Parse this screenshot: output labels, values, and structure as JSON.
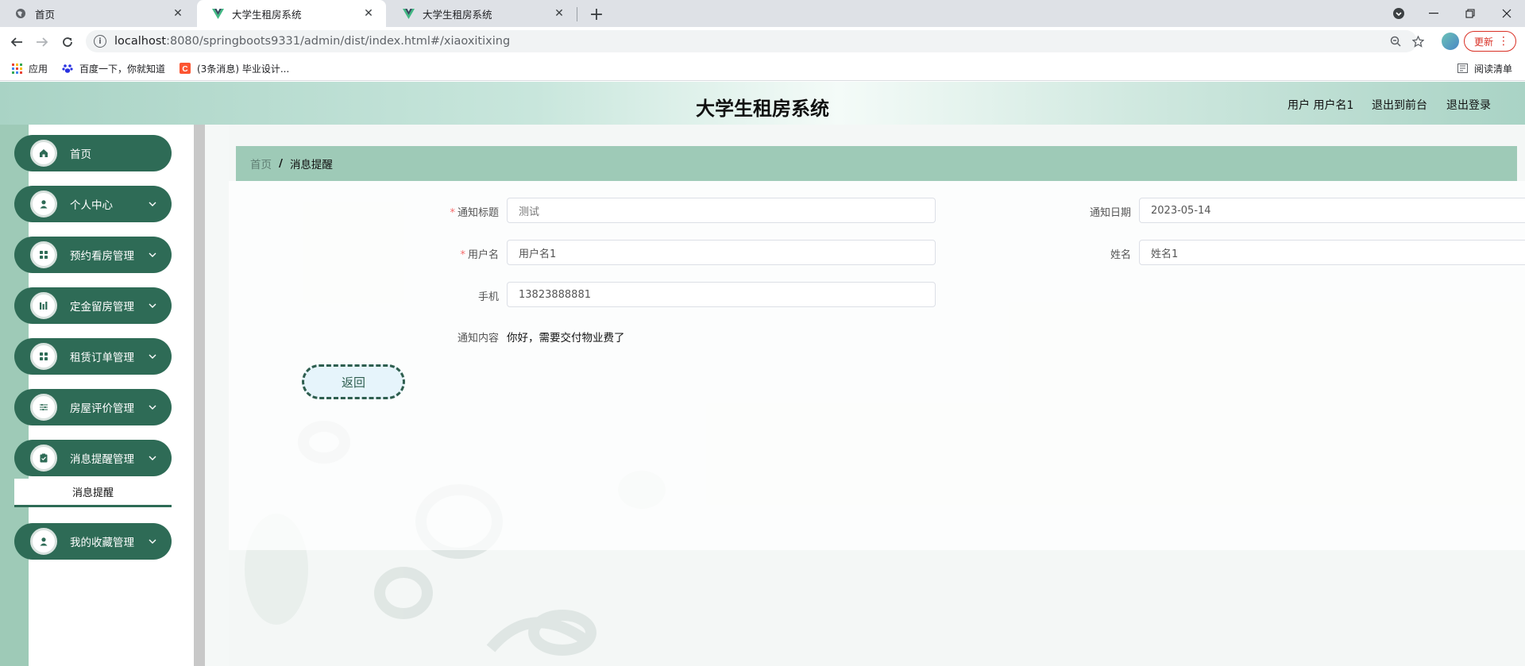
{
  "browser": {
    "tabs": [
      {
        "title": "首页",
        "icon": "globe-icon"
      },
      {
        "title": "大学生租房系统",
        "icon": "vue-icon",
        "active": true
      },
      {
        "title": "大学生租房系统",
        "icon": "vue-icon"
      }
    ],
    "address": {
      "host": "localhost",
      "rest": ":8080/springboots9331/admin/dist/index.html#/xiaoxitixing"
    },
    "update_label": "更新",
    "bookmarks": [
      {
        "label": "应用",
        "icon": "apps-grid-icon"
      },
      {
        "label": "百度一下，你就知道",
        "icon": "baidu-paw-icon"
      },
      {
        "label": "(3条消息) 毕业设计...",
        "icon": "csdn-c-icon"
      }
    ],
    "reading_list_label": "阅读清单"
  },
  "header": {
    "title": "大学生租房系统",
    "user_label": "用户 用户名1",
    "to_front_label": "退出到前台",
    "logout_label": "退出登录"
  },
  "sidebar": {
    "items": [
      {
        "label": "首页",
        "icon": "home-icon",
        "expandable": false
      },
      {
        "label": "个人中心",
        "icon": "user-icon",
        "expandable": true
      },
      {
        "label": "预约看房管理",
        "icon": "grid-icon",
        "expandable": true
      },
      {
        "label": "定金留房管理",
        "icon": "bars-icon",
        "expandable": true
      },
      {
        "label": "租赁订单管理",
        "icon": "grid-icon",
        "expandable": true
      },
      {
        "label": "房屋评价管理",
        "icon": "sliders-icon",
        "expandable": true
      },
      {
        "label": "消息提醒管理",
        "icon": "clipboard-icon",
        "expandable": true
      },
      {
        "label": "我的收藏管理",
        "icon": "user-icon",
        "expandable": true
      }
    ],
    "submenu_label": "消息提醒"
  },
  "breadcrumb": {
    "home": "首页",
    "separator": "/",
    "current": "消息提醒"
  },
  "form": {
    "title_label": "通知标题",
    "title_value": "测试",
    "date_label": "通知日期",
    "date_value": "2023-05-14",
    "username_label": "用户名",
    "username_value": "用户名1",
    "name_label": "姓名",
    "name_value": "姓名1",
    "phone_label": "手机",
    "phone_value": "13823888881",
    "content_label": "通知内容",
    "content_value": "你好，需要交付物业费了",
    "required_mark": "*",
    "back_label": "返回"
  },
  "colors": {
    "sidebar_item": "#2e6b56",
    "breadcrumb_bg": "#9ecab7",
    "required": "#f56c6c"
  }
}
